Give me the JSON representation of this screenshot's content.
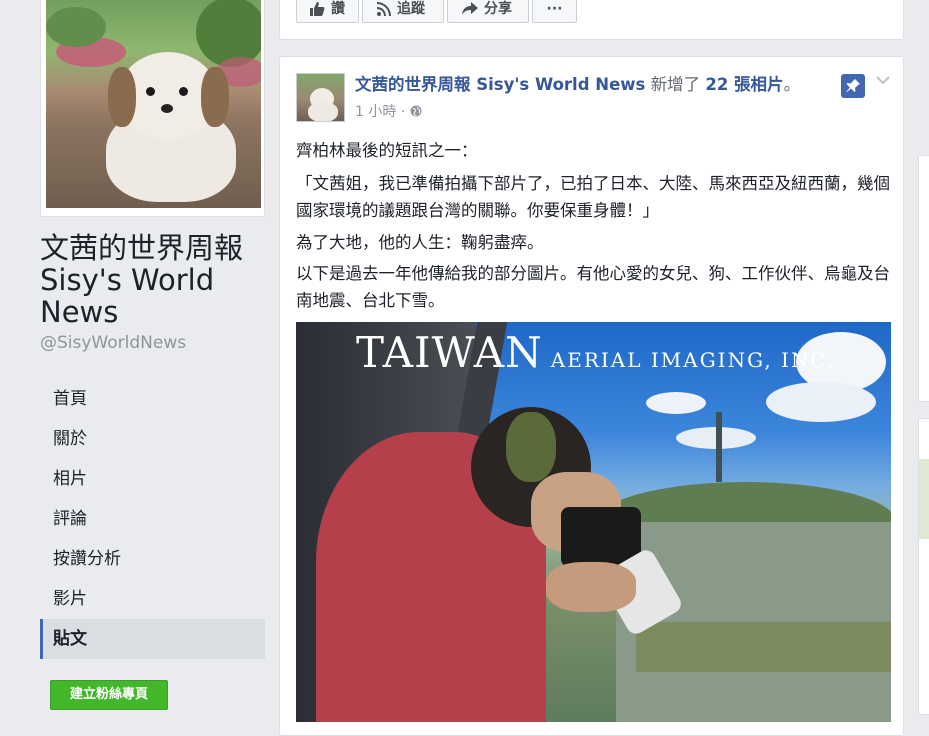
{
  "page": {
    "title": "文茜的世界周報 Sisy's World News",
    "handle": "@SisyWorldNews"
  },
  "nav": {
    "items": [
      {
        "label": "首頁"
      },
      {
        "label": "關於"
      },
      {
        "label": "相片"
      },
      {
        "label": "評論"
      },
      {
        "label": "按讚分析"
      },
      {
        "label": "影片"
      },
      {
        "label": "貼文",
        "active": true
      }
    ],
    "create_page_label": "建立粉絲專頁"
  },
  "actions": {
    "like": "讚",
    "follow": "追蹤",
    "share": "分享",
    "more": "···"
  },
  "post": {
    "author": "文茜的世界周報 Sisy's World News",
    "action_text": "新增了",
    "count_text": "22 張相片",
    "period": "。",
    "timestamp": "1 小時 ·",
    "paragraphs": [
      "齊柏林最後的短訊之一：",
      "「文茜姐，我已準備拍攝下部片了，已拍了日本、大陸、馬來西亞及紐西蘭，幾個國家環境的議題跟台灣的關聯。你要保重身體！」",
      "為了大地，他的人生：鞠躬盡瘁。",
      "以下是過去一年他傳給我的部分圖片。有他心愛的女兒、狗、工作伙伴、烏龜及台南地震、台北下雪。"
    ],
    "photo_watermark_big": "TAIWAN",
    "photo_watermark_small": "AERIAL IMAGING, INC."
  },
  "colors": {
    "link": "#365899",
    "accent": "#4267b2",
    "green_button": "#42b72a",
    "background": "#e9ebee"
  }
}
